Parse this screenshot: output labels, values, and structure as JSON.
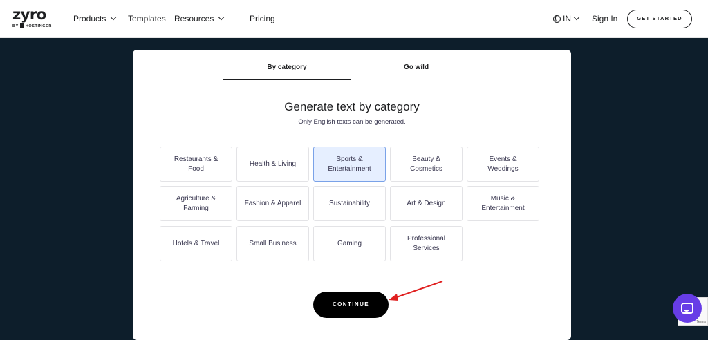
{
  "header": {
    "logo_word": "zyro",
    "logo_by": "BY",
    "logo_brand": "HOSTINGER",
    "nav": {
      "products": "Products",
      "templates": "Templates",
      "resources": "Resources",
      "pricing": "Pricing"
    },
    "lang": "IN",
    "sign_in": "Sign In",
    "get_started": "GET STARTED"
  },
  "tabs": {
    "by_category": "By category",
    "go_wild": "Go wild",
    "active": "By category"
  },
  "main": {
    "heading": "Generate text by category",
    "subheading": "Only English texts can be generated."
  },
  "categories": [
    "Restaurants & Food",
    "Health & Living",
    "Sports & Entertainment",
    "Beauty & Cosmetics",
    "Events & Weddings",
    "Agriculture & Farming",
    "Fashion & Apparel",
    "Sustainability",
    "Art & Design",
    "Music & Entertainment",
    "Hotels & Travel",
    "Small Business",
    "Gaming",
    "Professional Services"
  ],
  "selected_category": "Sports & Entertainment",
  "continue_label": "CONTINUE",
  "recaptcha_terms": "Terms",
  "colors": {
    "page_background": "#0d1e2b",
    "selected_background": "#e6efff",
    "selected_border": "#7aa2e8",
    "annotation_arrow": "#e02020",
    "chat_bubble": "#673de6"
  },
  "icons": {
    "globe": "globe-icon",
    "chevron": "chevron-down-icon",
    "chat": "chat-icon",
    "annotation": "red-arrow-annotation"
  }
}
